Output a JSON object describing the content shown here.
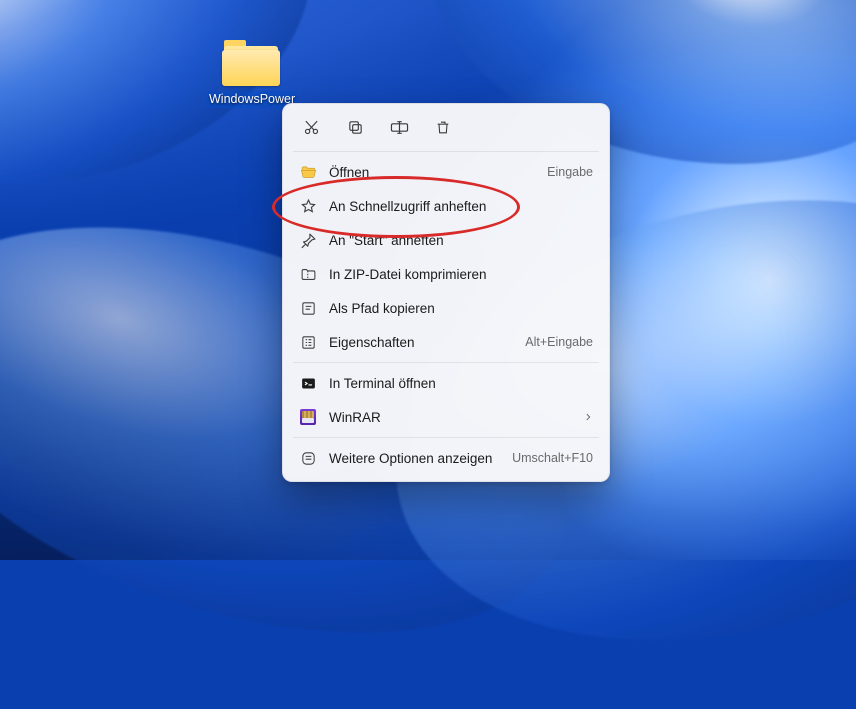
{
  "desktop": {
    "folder_label": "WindowsPower"
  },
  "context_menu": {
    "top_actions": {
      "cut": "Ausschneiden",
      "copy": "Kopieren",
      "rename": "Umbenennen",
      "delete": "Löschen"
    },
    "items": {
      "open": {
        "label": "Öffnen",
        "accel": "Eingabe"
      },
      "pin_quick_access": {
        "label": "An Schnellzugriff anheften",
        "accel": ""
      },
      "pin_start": {
        "label": "An \"Start\" anheften",
        "accel": ""
      },
      "zip": {
        "label": "In ZIP-Datei komprimieren",
        "accel": ""
      },
      "copy_path": {
        "label": "Als Pfad kopieren",
        "accel": ""
      },
      "properties": {
        "label": "Eigenschaften",
        "accel": "Alt+Eingabe"
      },
      "terminal": {
        "label": "In Terminal öffnen",
        "accel": ""
      },
      "winrar": {
        "label": "WinRAR",
        "accel": ""
      },
      "more_options": {
        "label": "Weitere Optionen anzeigen",
        "accel": "Umschalt+F10"
      }
    },
    "annotation": {
      "highlight_item": "pin_quick_access",
      "color": "#d92a2a"
    }
  }
}
